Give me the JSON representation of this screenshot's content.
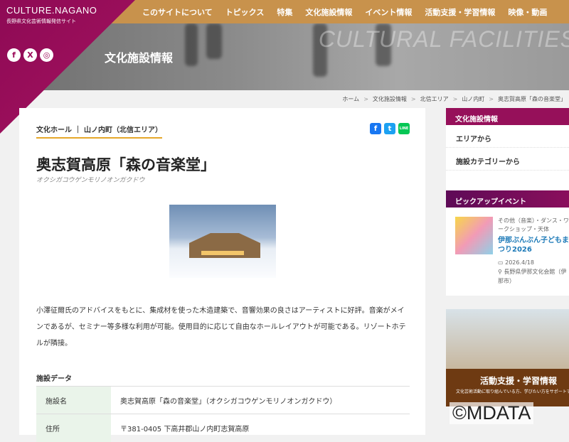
{
  "header": {
    "logo": "CULTURE.NAGANO",
    "logo_sub": "長野県文化芸術情報発信サイト",
    "hero_bg_text": "CULTURAL FACILITIES",
    "hero_title": "文化施設情報",
    "sns": [
      "f",
      "X",
      "◎"
    ]
  },
  "nav": [
    "このサイトについて",
    "トピックス",
    "特集",
    "文化施設情報",
    "イベント情報",
    "活動支援・学習情報",
    "映像・動画"
  ],
  "breadcrumb": [
    "ホーム",
    "文化施設情報",
    "北信エリア",
    "山ノ内町",
    "奥志賀高原「森の音楽堂」"
  ],
  "breadcrumb_sep": ">",
  "article": {
    "category": "文化ホール ｜ 山ノ内町（北信エリア）",
    "title": "奥志賀高原「森の音楽堂」",
    "kana": "オクシガコウゲンモリノオンガクドウ",
    "share": [
      "f",
      "t",
      "LINE"
    ],
    "description": "小澤征爾氏のアドバイスをもとに、集成材を使った木造建築で、音響効果の良さはアーティストに好評。音楽がメインであるが、セミナー等多様な利用が可能。使用目的に応じて自由なホールレイアウトが可能である。リゾートホテルが隣接。",
    "data_heading": "施設データ",
    "data": [
      {
        "k": "施設名",
        "v": "奥志賀高原「森の音楽堂」（オクシガコウゲンモリノオンガクドウ）"
      },
      {
        "k": "住所",
        "v": "〒381-0405 下高井郡山ノ内町志賀高原"
      }
    ]
  },
  "sidebar": {
    "facility_heading": "文化施設情報",
    "facility_links": [
      "エリアから",
      "施設カテゴリーから"
    ],
    "pickup_heading": "ピックアップイベント",
    "event": {
      "category": "その他（音楽）・ダンス・ワークショップ・天体",
      "title": "伊那ぶんぶん子どもまつり2026",
      "date": "2026.4/18",
      "venue": "長野県伊那文化会館（伊那市）"
    },
    "banner_title": "活動支援・学習情報",
    "banner_sub": "文化芸術活動に取り組んでいる方、学びたい方をサポートする情報を掲載しています"
  },
  "watermark": "©MDATA"
}
